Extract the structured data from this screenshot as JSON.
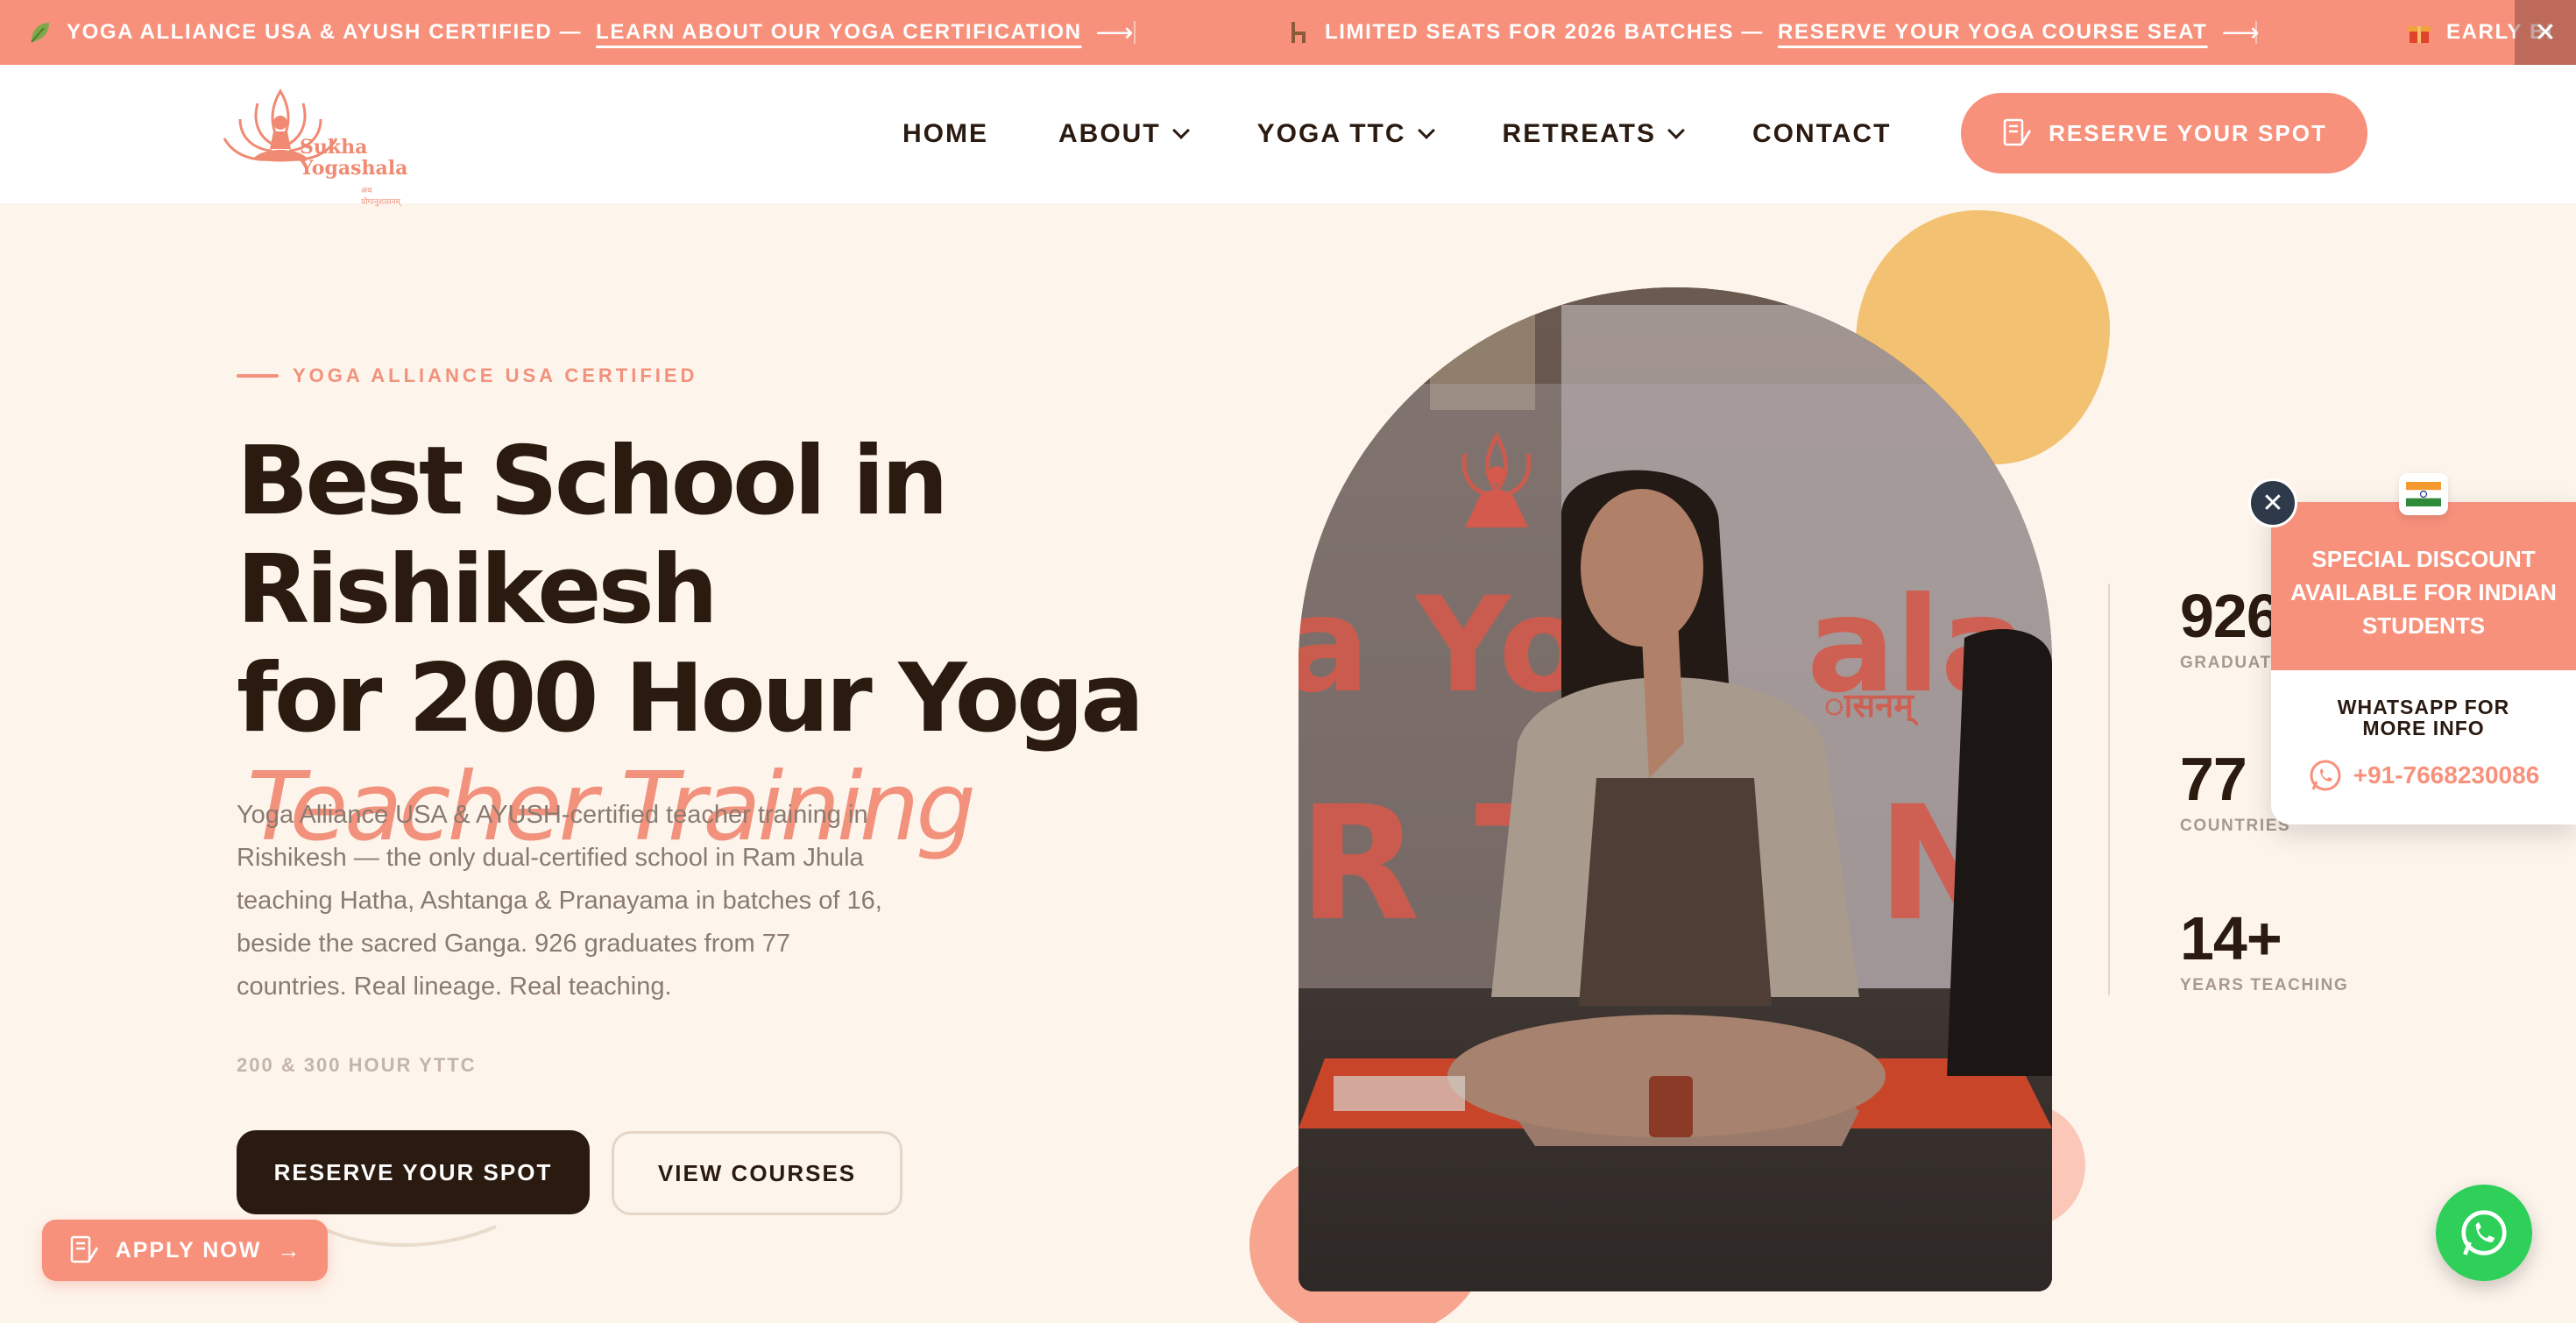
{
  "announcement": {
    "items": [
      {
        "icon": "leaf-icon",
        "text": "YOGA ALLIANCE USA & AYUSH CERTIFIED —",
        "link": "LEARN ABOUT OUR YOGA CERTIFICATION"
      },
      {
        "icon": "chair-icon",
        "text": "LIMITED SEATS FOR 2026 BATCHES —",
        "link": "RESERVE YOUR YOGA COURSE SEAT"
      },
      {
        "icon": "gift-icon",
        "text": "EARLY BI"
      }
    ],
    "close_label": "✕"
  },
  "header": {
    "logo": {
      "line1": "Sukha",
      "line2": "Yogashala",
      "sub": "अथ योगानुशासनम्"
    },
    "nav": [
      {
        "label": "HOME",
        "dropdown": false
      },
      {
        "label": "ABOUT",
        "dropdown": true
      },
      {
        "label": "YOGA TTC",
        "dropdown": true
      },
      {
        "label": "RETREATS",
        "dropdown": true
      },
      {
        "label": "CONTACT",
        "dropdown": false
      }
    ],
    "cta_label": "RESERVE YOUR SPOT"
  },
  "hero": {
    "eyebrow": "YOGA ALLIANCE USA CERTIFIED",
    "headline_line1": "Best School in Rishikesh",
    "headline_line2": "for 200 Hour Yoga",
    "headline_accent": "Teacher Training",
    "description": "Yoga Alliance USA & AYUSH-certified teacher training in Rishikesh — the only dual-certified school in Ram Jhula teaching Hatha, Ashtanga & Pranayama in batches of 16, beside the sacred Ganga. 926 graduates from 77 countries. Real lineage. Real teaching.",
    "sublabel": "200 & 300 HOUR YTTC",
    "primary_button": "RESERVE YOUR SPOT",
    "secondary_button": "VIEW COURSES"
  },
  "photo": {
    "banner_text_1": "a Yog",
    "banner_text_2": "ala",
    "banner_text_3": "R T",
    "banner_text_4": "NC",
    "banner_text_hindi": "ासनम्"
  },
  "stats": [
    {
      "num": "926",
      "label": "GRADUATES"
    },
    {
      "num": "77",
      "label": "COUNTRIES"
    },
    {
      "num": "14+",
      "label": "YEARS TEACHING"
    }
  ],
  "popup": {
    "headline": "SPECIAL DISCOUNT AVAILABLE FOR INDIAN STUDENTS",
    "cta": "WHATSAPP FOR MORE INFO",
    "phone": "+91-7668230086",
    "close_label": "✕"
  },
  "apply_button": "APPLY NOW",
  "colors": {
    "accent": "#f7917c",
    "dark": "#2a1a10",
    "background": "#fdf5ec",
    "yellow": "#f2c171",
    "whatsapp": "#2ed05a"
  }
}
